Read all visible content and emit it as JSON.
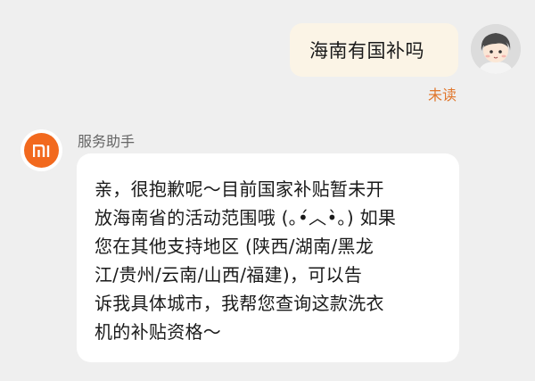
{
  "conversation": {
    "user_message": {
      "text": "海南有国补吗",
      "status": "未读"
    },
    "bot_message": {
      "sender_name": "服务助手",
      "lines": [
        "亲，很抱歉呢～目前国家补贴暂未开",
        "放海南省的活动范围哦 (｡•́︿•̀｡) 如果",
        "您在其他支持地区 (陕西/湖南/黑龙",
        "江/贵州/云南/山西/福建)，可以告",
        "诉我具体城市，我帮您查询这款洗衣",
        "机的补贴资格～"
      ]
    }
  },
  "icons": {
    "user_avatar": "cartoon-avatar-icon",
    "bot_avatar": "mi-logo-icon"
  },
  "colors": {
    "background": "#efefef",
    "user_bubble": "#fbf4e6",
    "bot_bubble": "#ffffff",
    "status_unread": "#e0762b",
    "brand": "#f2691e"
  }
}
